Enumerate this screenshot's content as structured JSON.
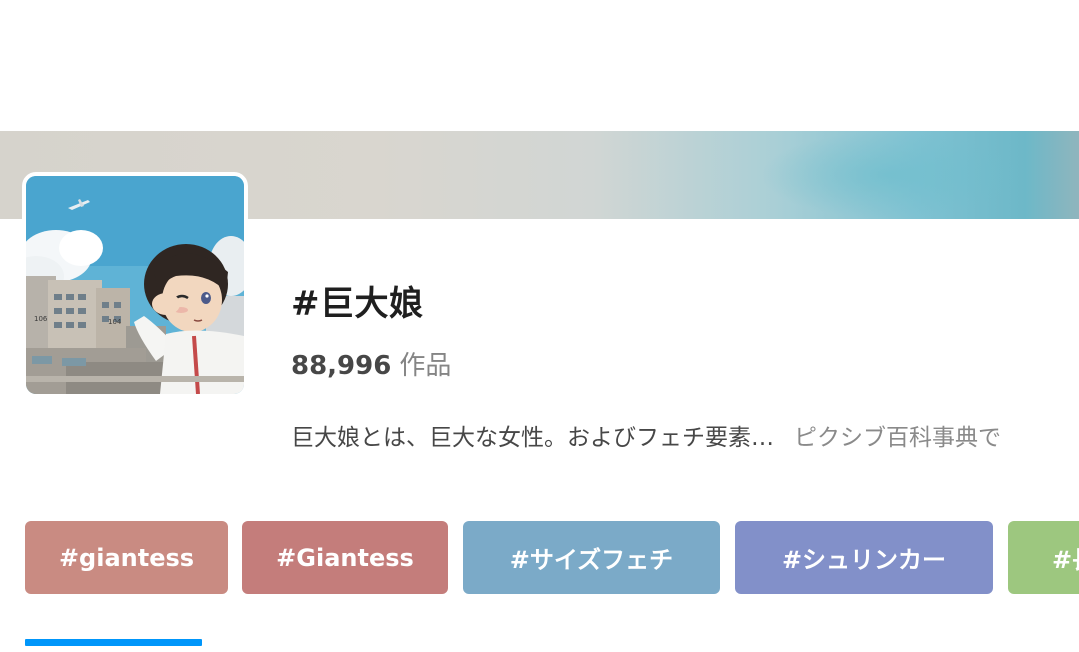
{
  "tag_page": {
    "title": "#巨大娘",
    "works_count": "88,996",
    "works_unit": "作品",
    "description": "巨大娘とは、巨大な女性。およびフェチ要素…",
    "description_source": "ピクシブ百科事典で"
  },
  "related_tags": [
    {
      "label": "#giantess",
      "color": "#c98b82"
    },
    {
      "label": "#Giantess",
      "color": "#c47d7b"
    },
    {
      "label": "#サイズフェチ",
      "color": "#7baac8"
    },
    {
      "label": "#シュリンカー",
      "color": "#8290c9"
    },
    {
      "label": "#長",
      "color": "#9dc77f"
    }
  ],
  "avatar_image": {
    "labels": [
      "106",
      "104"
    ]
  },
  "colors": {
    "tab_indicator": "#0096fa"
  }
}
